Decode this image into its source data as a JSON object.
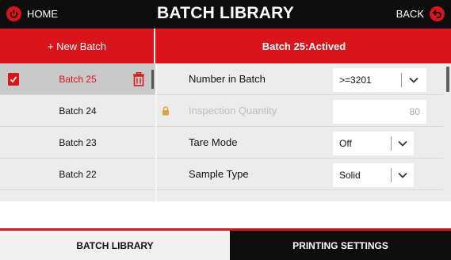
{
  "header": {
    "title": "BATCH LIBRARY",
    "home_label": "HOME",
    "back_label": "BACK"
  },
  "toolbar": {
    "new_batch_label": "+ New Batch",
    "batch_status": "Batch 25:Actived"
  },
  "batches": [
    {
      "label": "Batch 25",
      "selected": true
    },
    {
      "label": "Batch 24",
      "selected": false
    },
    {
      "label": "Batch 23",
      "selected": false
    },
    {
      "label": "Batch 22",
      "selected": false
    }
  ],
  "settings": [
    {
      "label": "Number in Batch",
      "value": ">=3201",
      "type": "dropdown",
      "enabled": true
    },
    {
      "label": "Inspection Quantity",
      "value": "80",
      "type": "number",
      "enabled": false
    },
    {
      "label": "Tare Mode",
      "value": "Off",
      "type": "dropdown",
      "enabled": true
    },
    {
      "label": "Sample Type",
      "value": "Solid",
      "type": "dropdown",
      "enabled": true
    }
  ],
  "tabs": [
    {
      "label": "BATCH LIBRARY",
      "active": true
    },
    {
      "label": "PRINTING SETTINGS",
      "active": false
    }
  ],
  "colors": {
    "accent": "#d9141b",
    "dark": "#0d0d0d",
    "panel": "#ececec",
    "selected_row": "#c9c9c9"
  },
  "icons": {
    "home": "home-circle-icon",
    "back": "back-arrow-circle-icon",
    "document": "document-icon",
    "trash": "trash-icon",
    "lock": "lock-icon",
    "chevron": "chevron-down-icon"
  }
}
